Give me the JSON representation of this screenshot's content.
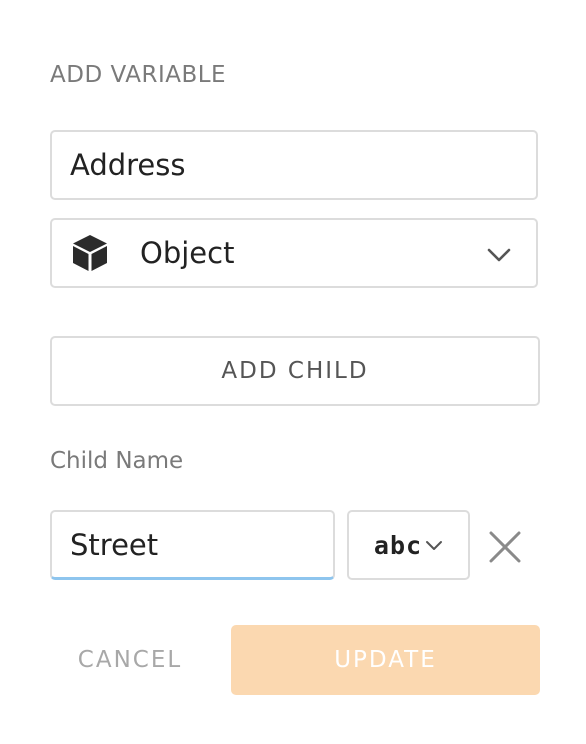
{
  "dialog": {
    "title": "ADD VARIABLE"
  },
  "variable": {
    "name_value": "Address",
    "type_label": "Object",
    "type_icon": "cube-icon"
  },
  "actions": {
    "add_child_label": "ADD CHILD",
    "cancel_label": "CANCEL",
    "update_label": "UPDATE",
    "update_color": "#fbd8b0"
  },
  "child": {
    "section_label": "Child Name",
    "name_value": "Street",
    "type_glyph": "abc",
    "type_icon": "text-type-icon"
  },
  "colors": {
    "focus_underline": "#8ec5ee",
    "border": "#dcdcdc"
  }
}
